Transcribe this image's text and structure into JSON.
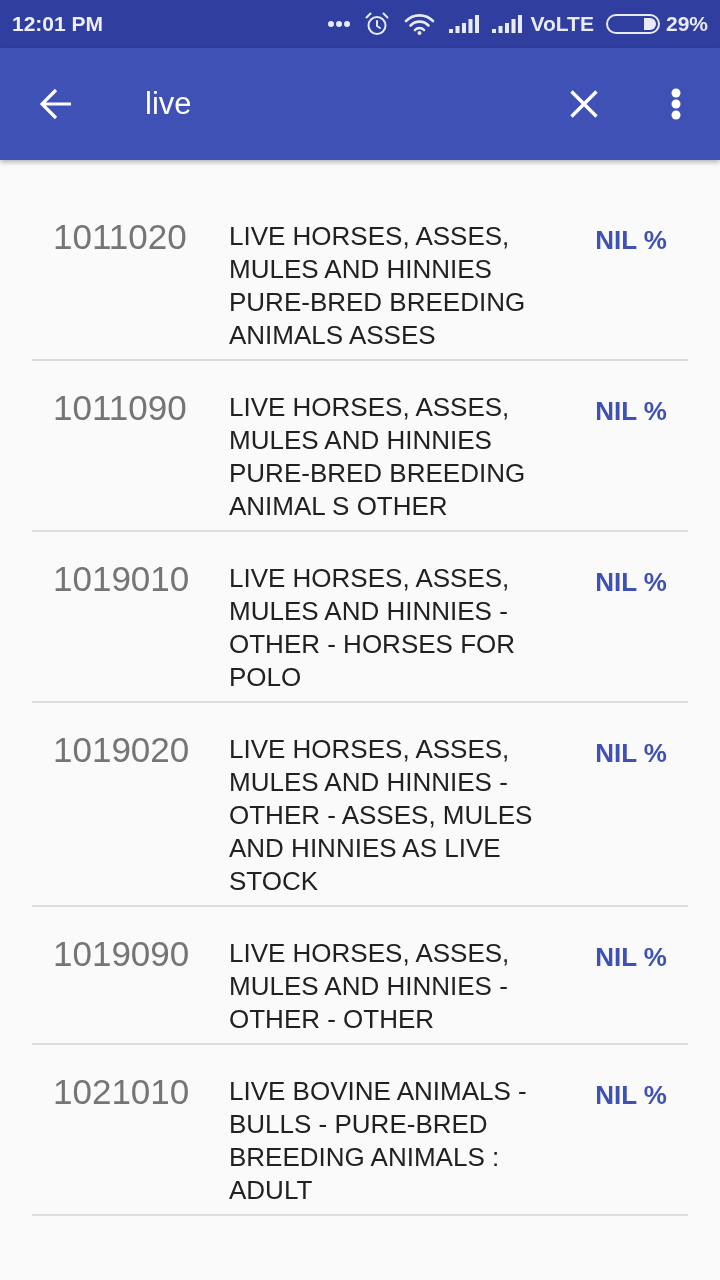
{
  "status_bar": {
    "time": "12:01 PM",
    "network": "VoLTE",
    "battery": "29%"
  },
  "toolbar": {
    "search": {
      "value": "live"
    }
  },
  "results": [
    {
      "code": "1011020",
      "description": "LIVE HORSES, ASSES, MULES AND HINNIES PURE-BRED BREEDING ANIMALS ASSES",
      "duty": "NIL %"
    },
    {
      "code": "1011090",
      "description": "LIVE HORSES, ASSES, MULES AND HINNIES PURE-BRED BREEDING ANIMAL S OTHER",
      "duty": "NIL %"
    },
    {
      "code": "1019010",
      "description": "LIVE HORSES, ASSES, MULES AND HINNIES - OTHER - HORSES FOR POLO",
      "duty": "NIL %"
    },
    {
      "code": "1019020",
      "description": "LIVE HORSES, ASSES, MULES AND HINNIES - OTHER - ASSES, MULES AND HINNIES AS LIVE STOCK",
      "duty": "NIL %"
    },
    {
      "code": "1019090",
      "description": "LIVE HORSES, ASSES, MULES AND HINNIES - OTHER - OTHER",
      "duty": "NIL %"
    },
    {
      "code": "1021010",
      "description": "LIVE BOVINE ANIMALS - BULLS - PURE-BRED BREEDING ANIMALS : ADULT",
      "duty": "NIL %"
    }
  ]
}
